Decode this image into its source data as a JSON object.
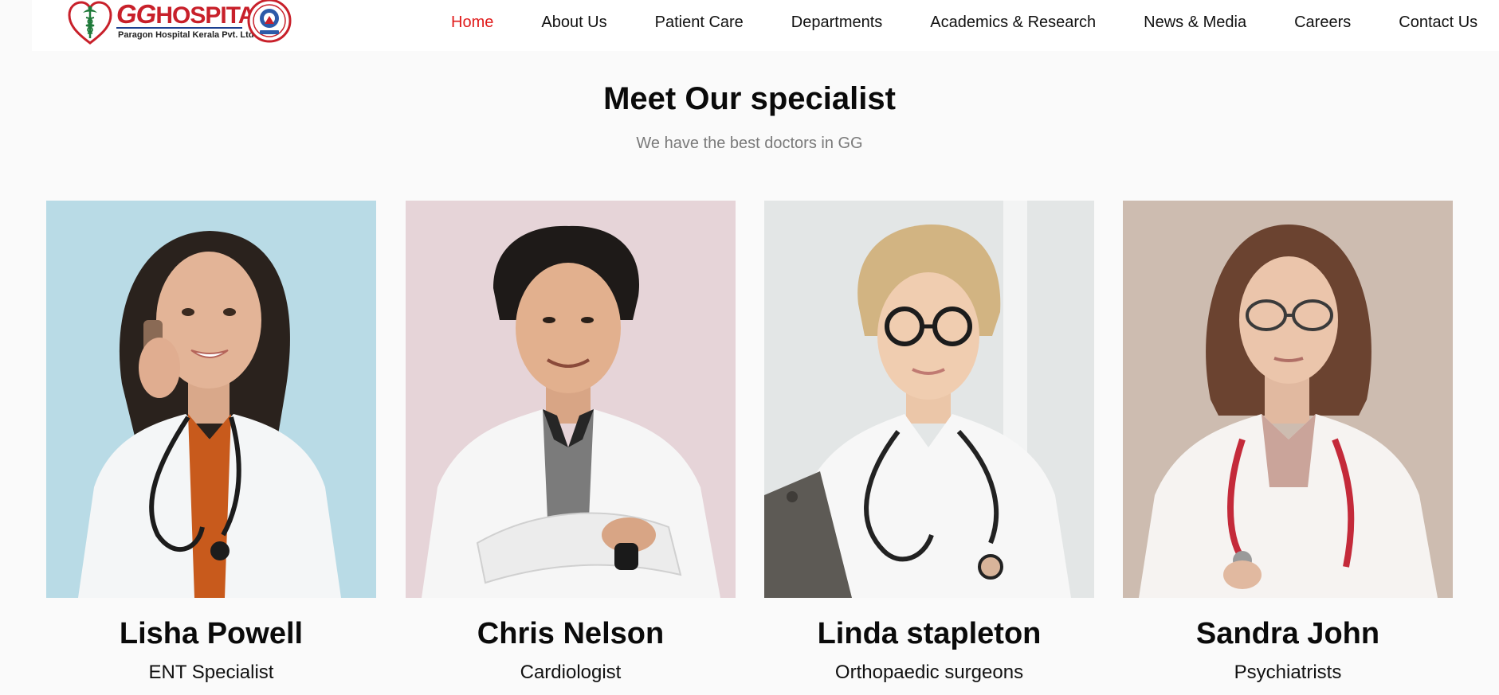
{
  "header": {
    "logo": {
      "title_gg": "GG",
      "title_rest": "HOSPITAL",
      "subtitle": "Paragon Hospital Kerala Pvt. Ltd"
    },
    "nav": [
      {
        "label": "Home",
        "active": true
      },
      {
        "label": "About Us"
      },
      {
        "label": "Patient Care"
      },
      {
        "label": "Departments"
      },
      {
        "label": "Academics & Research"
      },
      {
        "label": "News & Media"
      },
      {
        "label": "Careers"
      },
      {
        "label": "Contact Us"
      }
    ],
    "active_color": "#e01b1b"
  },
  "section": {
    "title": "Meet Our specialist",
    "subtitle": "We have the best doctors in GG"
  },
  "doctors": [
    {
      "name": "Lisha Powell",
      "role": "ENT Specialist"
    },
    {
      "name": "Chris Nelson",
      "role": "Cardiologist"
    },
    {
      "name": "Linda stapleton",
      "role": "Orthopaedic surgeons"
    },
    {
      "name": "Sandra John",
      "role": "Psychiatrists"
    }
  ]
}
